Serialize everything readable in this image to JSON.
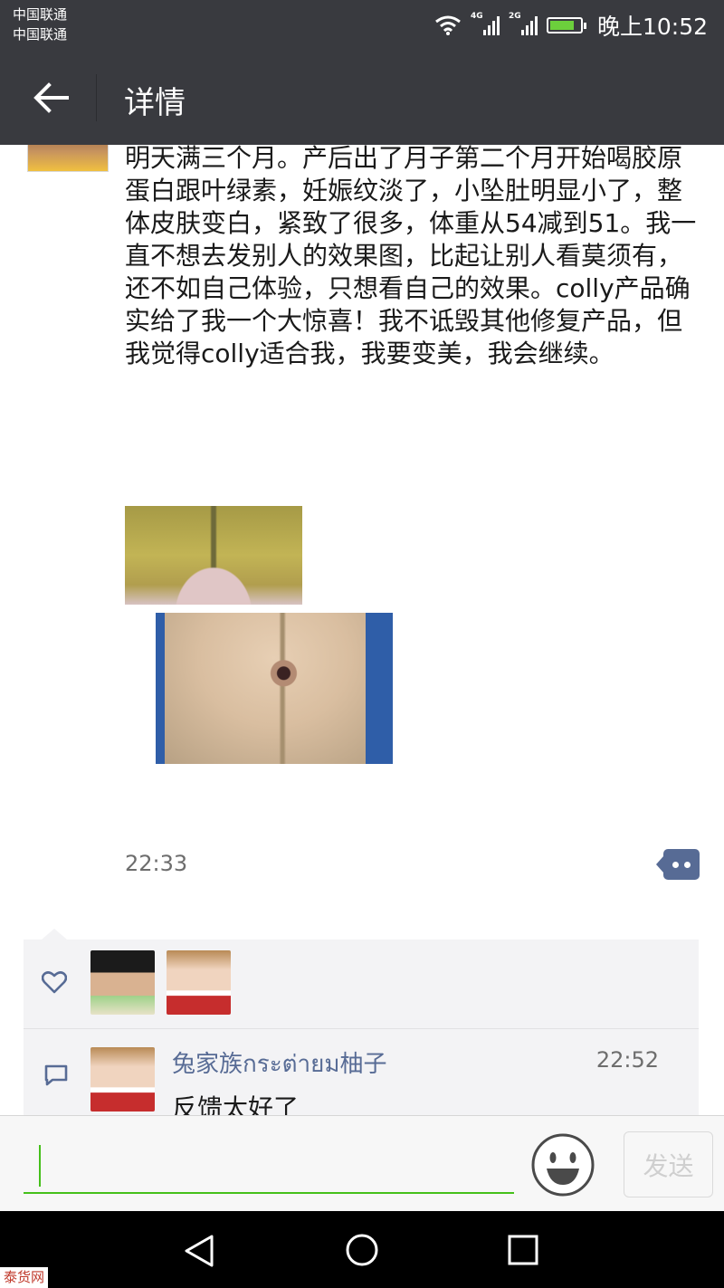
{
  "status_bar": {
    "carrier_1": "中国联通",
    "carrier_2": "中国联通",
    "network_1": "4G",
    "network_2": "2G",
    "battery_level": 0.8,
    "time": "晚上10:52"
  },
  "nav": {
    "back_icon": "arrow-left-icon",
    "title": "详情"
  },
  "post": {
    "text": "明天满三个月。产后出了月子第二个月开始喝胶原蛋白跟叶绿素，妊娠纹淡了，小坠肚明显小了，整体皮肤变白，紧致了很多，体重从54减到51。我一直不想去发别人的效果图，比起让别人看莫须有，还不如自己体验，只想看自己的效果。colly产品确实给了我一个大惊喜！我不诋毁其他修复产品，但我觉得colly适合我，我要变美，我会继续。",
    "time": "22:33",
    "comment_button_icon": "more-dots-icon"
  },
  "likes": {
    "icon": "heart-icon",
    "count_avatars": 2
  },
  "comments": [
    {
      "name": "兔家族กระต่ายม柚子",
      "time": "22:52",
      "text": "反馈太好了"
    }
  ],
  "input": {
    "value": "",
    "emoji_icon": "smiley-icon",
    "send_label": "发送"
  },
  "android_nav": {
    "back_icon": "triangle-back-icon",
    "home_icon": "circle-home-icon",
    "recent_icon": "square-recents-icon"
  },
  "watermark": "泰货网",
  "colors": {
    "bar_bg": "#393a3f",
    "link_blue": "#576b95",
    "accent_green": "#45c01a",
    "panel_bg": "#f3f3f5"
  }
}
